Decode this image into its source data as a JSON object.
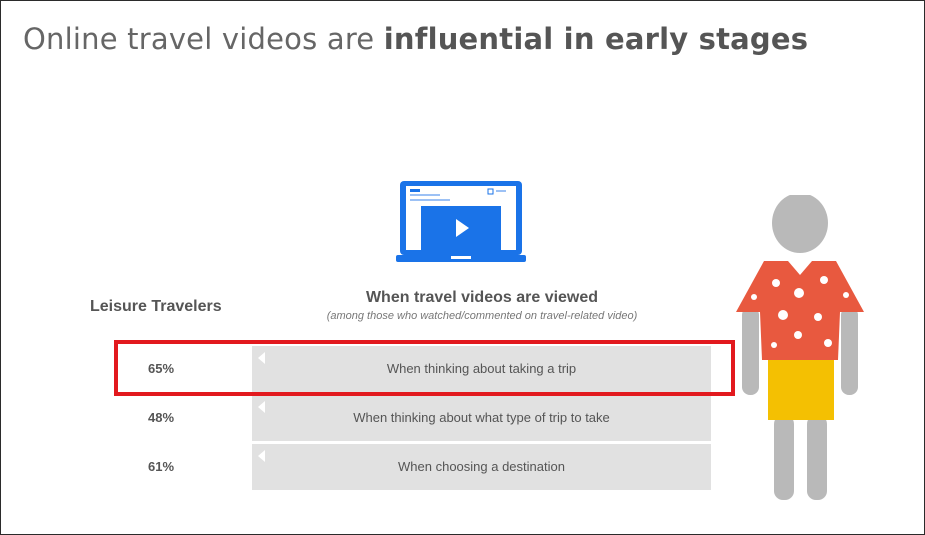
{
  "title_light": "Online travel videos are",
  "title_bold": "influential in early stages",
  "column_heading": "Leisure Travelers",
  "colors": {
    "laptop": "#1a73e8",
    "shirt": "#e8593f",
    "shorts": "#f4c002",
    "figure": "#b9b9b9",
    "highlight": "#e2191e",
    "bar": "#e1e1e1"
  },
  "icons": [
    "laptop-video-icon",
    "traveler-figure-icon"
  ],
  "chart_data": {
    "type": "bar",
    "title": "When travel videos are viewed",
    "subtitle": "(among those who watched/commented on travel-related video)",
    "categories": [
      "When thinking about taking a trip",
      "When thinking about what type of trip to take",
      "When choosing a destination"
    ],
    "values": [
      65,
      48,
      61
    ],
    "value_labels": [
      "65%",
      "48%",
      "61%"
    ],
    "highlighted_index": 0
  }
}
